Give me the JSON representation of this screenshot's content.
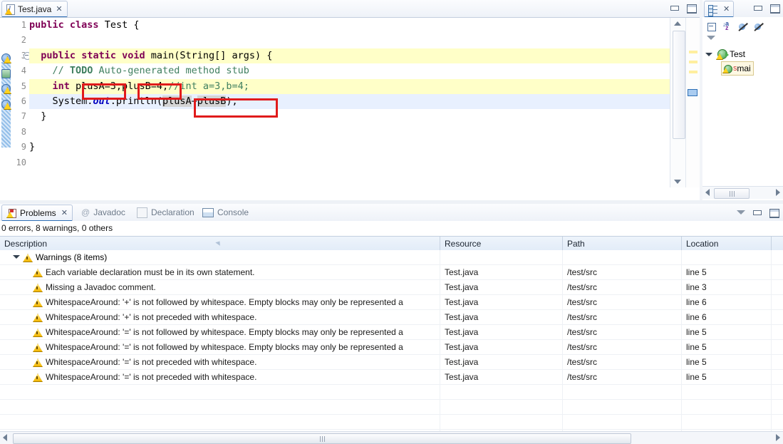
{
  "editor": {
    "tab": {
      "label": "Test.java",
      "close": "✕",
      "icon": "java-file-icon"
    },
    "window_buttons": {
      "minimize": "minimize-icon",
      "maximize": "maximize-icon"
    },
    "line_numbers": [
      "1",
      "2",
      "3",
      "4",
      "5",
      "6",
      "7",
      "8",
      "9",
      "10"
    ],
    "code_lines": [
      {
        "n": "1",
        "tokens": [
          {
            "t": "public",
            "c": "kw"
          },
          {
            "t": " ",
            "c": "plain"
          },
          {
            "t": "class",
            "c": "kw"
          },
          {
            "t": " Test {",
            "c": "plain"
          }
        ]
      },
      {
        "n": "2",
        "tokens": []
      },
      {
        "n": "3",
        "tokens": [
          {
            "t": "  ",
            "c": "plain"
          },
          {
            "t": "public",
            "c": "kw"
          },
          {
            "t": " ",
            "c": "plain"
          },
          {
            "t": "static",
            "c": "kw"
          },
          {
            "t": " ",
            "c": "plain"
          },
          {
            "t": "void",
            "c": "kw"
          },
          {
            "t": " main(String[] args) {",
            "c": "plain"
          }
        ]
      },
      {
        "n": "4",
        "tokens": [
          {
            "t": "    // ",
            "c": "cmt"
          },
          {
            "t": "TODO",
            "c": "todo"
          },
          {
            "t": " Auto-generated method stub",
            "c": "cmt"
          }
        ]
      },
      {
        "n": "5",
        "tokens": [
          {
            "t": "    ",
            "c": "plain"
          },
          {
            "t": "int",
            "c": "kw"
          },
          {
            "t": " plusA=3,plusB=4;",
            "c": "plain"
          },
          {
            "t": "//int a=3,b=4;",
            "c": "cmt"
          }
        ]
      },
      {
        "n": "6",
        "tokens": [
          {
            "t": "    System.",
            "c": "plain"
          },
          {
            "t": "out",
            "c": "fld"
          },
          {
            "t": ".println(plusA+plusB);",
            "c": "plain"
          }
        ]
      },
      {
        "n": "7",
        "tokens": [
          {
            "t": "  }",
            "c": "plain"
          }
        ]
      },
      {
        "n": "8",
        "tokens": []
      },
      {
        "n": "9",
        "tokens": [
          {
            "t": "}",
            "c": "plain"
          }
        ]
      },
      {
        "n": "10",
        "tokens": []
      }
    ],
    "raw_code": "public class Test {\n\n  public static void main(String[] args) {\n    // TODO Auto-generated method stub\n    int plusA=3,plusB=4;//int a=3,b=4;\n    System.out.println(plusA+plusB);\n  }\n\n}\n",
    "annotations": [
      {
        "name": "redbox-plusA-decl",
        "label": "plusA"
      },
      {
        "name": "redbox-plusB-decl",
        "label": "plusB"
      },
      {
        "name": "redbox-plusA-plusB-usage",
        "label": "plusA+plusB"
      }
    ],
    "gutter_markers": [
      {
        "line": "3",
        "kind": "warning-marker"
      },
      {
        "line": "4",
        "kind": "todo-marker"
      },
      {
        "line": "5",
        "kind": "warning-marker"
      },
      {
        "line": "6",
        "kind": "warning-marker"
      }
    ],
    "colors": {
      "keyword": "#7f0055",
      "comment": "#3f7f5f",
      "field": "#0000c0",
      "warning_line_highlight": "#ffffc8",
      "current_line_highlight": "#e8f0fe",
      "occurrence_highlight": "#d4d4d4",
      "annotation_box": "#e01b1b"
    }
  },
  "outline": {
    "tab": {
      "label": "",
      "icon": "outline-icon",
      "close": "✕"
    },
    "toolbar": [
      {
        "name": "collapse-all-icon",
        "label": ""
      },
      {
        "name": "sort-az-icon",
        "label": "az"
      },
      {
        "name": "hide-fields-icon",
        "label": ""
      },
      {
        "name": "hide-static-icon",
        "label": ""
      }
    ],
    "view_menu": "view-menu-icon",
    "tree": [
      {
        "label": "Test",
        "kind": "class",
        "expanded": true
      },
      {
        "label": "mai",
        "kind": "method",
        "static_marker": "S"
      }
    ]
  },
  "problems": {
    "tabs": [
      {
        "label": "Problems",
        "active": true,
        "icon": "problems-icon",
        "close": "✕"
      },
      {
        "label": "Javadoc",
        "active": false,
        "icon": "javadoc-icon"
      },
      {
        "label": "Declaration",
        "active": false,
        "icon": "declaration-icon"
      },
      {
        "label": "Console",
        "active": false,
        "icon": "console-icon"
      }
    ],
    "summary": "0 errors, 8 warnings, 0 others",
    "window_buttons": {
      "view_menu": "view-menu-icon",
      "minimize": "minimize-icon",
      "maximize": "maximize-icon"
    },
    "columns": [
      "Description",
      "Resource",
      "Path",
      "Location",
      ""
    ],
    "group": {
      "label": "Warnings (8 items)",
      "expanded": true
    },
    "rows": [
      {
        "description": "Each variable declaration must be in its own statement.",
        "resource": "Test.java",
        "path": "/test/src",
        "location": "line 5",
        "type": ""
      },
      {
        "description": "Missing a Javadoc comment.",
        "resource": "Test.java",
        "path": "/test/src",
        "location": "line 3",
        "type": ""
      },
      {
        "description": "WhitespaceAround: '+' is not followed by whitespace. Empty blocks may only be represented a",
        "resource": "Test.java",
        "path": "/test/src",
        "location": "line 6",
        "type": ""
      },
      {
        "description": "WhitespaceAround: '+' is not preceded with whitespace.",
        "resource": "Test.java",
        "path": "/test/src",
        "location": "line 6",
        "type": ""
      },
      {
        "description": "WhitespaceAround: '=' is not followed by whitespace. Empty blocks may only be represented a",
        "resource": "Test.java",
        "path": "/test/src",
        "location": "line 5",
        "type": ""
      },
      {
        "description": "WhitespaceAround: '=' is not followed by whitespace. Empty blocks may only be represented a",
        "resource": "Test.java",
        "path": "/test/src",
        "location": "line 5",
        "type": ""
      },
      {
        "description": "WhitespaceAround: '=' is not preceded with whitespace.",
        "resource": "Test.java",
        "path": "/test/src",
        "location": "line 5",
        "type": ""
      },
      {
        "description": "WhitespaceAround: '=' is not preceded with whitespace.",
        "resource": "Test.java",
        "path": "/test/src",
        "location": "line 5",
        "type": ""
      }
    ]
  }
}
